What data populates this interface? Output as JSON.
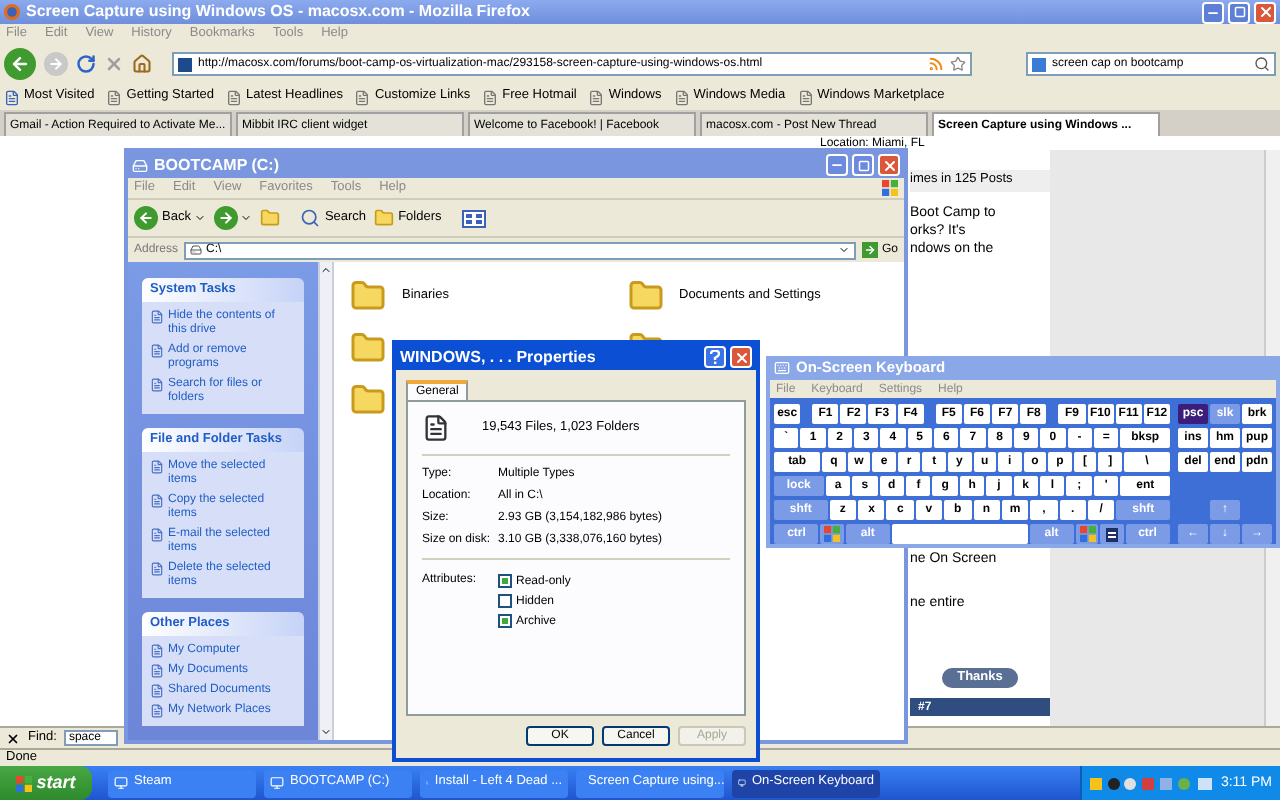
{
  "browser": {
    "title": "Screen Capture using Windows OS - macosx.com - Mozilla Firefox",
    "menu": [
      "File",
      "Edit",
      "View",
      "History",
      "Bookmarks",
      "Tools",
      "Help"
    ],
    "url": "http://macosx.com/forums/boot-camp-os-virtualization-mac/293158-screen-capture-using-windows-os.html",
    "search": "screen cap on bootcamp",
    "bookmarks": [
      "Most Visited",
      "Getting Started",
      "Latest Headlines",
      "Customize Links",
      "Free Hotmail",
      "Windows",
      "Windows Media",
      "Windows Marketplace"
    ],
    "tabs": [
      {
        "label": "Gmail - Action Required to Activate Me...",
        "selected": false
      },
      {
        "label": "Mibbit IRC client widget",
        "selected": false
      },
      {
        "label": "Welcome to Facebook! | Facebook",
        "selected": false
      },
      {
        "label": "macosx.com - Post New Thread",
        "selected": false
      },
      {
        "label": "Screen Capture using Windows ...",
        "selected": true
      }
    ],
    "page": {
      "location": "Location: Miami, FL",
      "posts": "imes in 125 Posts",
      "lines": [
        "Boot Camp to",
        "orks? It's",
        "ndows on the"
      ],
      "lines_lower": [
        "ne On Screen",
        "ne entire"
      ],
      "thanks": "Thanks",
      "post_number": "#7"
    },
    "find": {
      "label": "Find:",
      "value": "space"
    },
    "status": "Done"
  },
  "explorer": {
    "title": "BOOTCAMP (C:)",
    "menu": [
      "File",
      "Edit",
      "View",
      "Favorites",
      "Tools",
      "Help"
    ],
    "back": "Back",
    "search": "Search",
    "folders_button": "Folders",
    "address_label": "Address",
    "address": "C:\\",
    "go": "Go",
    "panels": [
      {
        "title": "System Tasks",
        "items": [
          "Hide the contents of this drive",
          "Add or remove programs",
          "Search for files or folders"
        ]
      },
      {
        "title": "File and Folder Tasks",
        "items": [
          "Move the selected items",
          "Copy the selected items",
          "E-mail the selected items",
          "Delete the selected items"
        ]
      },
      {
        "title": "Other Places",
        "items": [
          "My Computer",
          "My Documents",
          "Shared Documents",
          "My Network Places"
        ]
      }
    ],
    "folders": [
      "Binaries",
      "Documents and Settings"
    ]
  },
  "properties": {
    "title": "WINDOWS, . . . Properties",
    "tabs": [
      {
        "label": "General",
        "selected": true
      }
    ],
    "summary": "19,543 Files, 1,023 Folders",
    "fields": [
      {
        "label": "Type:",
        "value": "Multiple Types"
      },
      {
        "label": "Location:",
        "value": "All in C:\\"
      },
      {
        "label": "Size:",
        "value": "2.93 GB (3,154,182,986 bytes)"
      },
      {
        "label": "Size on disk:",
        "value": "3.10 GB (3,338,076,160 bytes)"
      }
    ],
    "attributes_label": "Attributes:",
    "attributes": [
      {
        "label": "Read-only",
        "checked": true
      },
      {
        "label": "Hidden",
        "checked": false
      },
      {
        "label": "Archive",
        "checked": true
      }
    ],
    "buttons": [
      {
        "label": "OK",
        "disabled": false
      },
      {
        "label": "Cancel",
        "disabled": false
      },
      {
        "label": "Apply",
        "disabled": true
      }
    ]
  },
  "keyboard": {
    "title": "On-Screen Keyboard",
    "menu": [
      "File",
      "Keyboard",
      "Settings",
      "Help"
    ],
    "key_lines": [
      [
        {
          "label": "esc",
          "kind": "key",
          "pressed": false
        },
        {
          "label": "F1",
          "kind": "key",
          "pressed": false
        },
        {
          "label": "F2",
          "kind": "key",
          "pressed": false
        },
        {
          "label": "F3",
          "kind": "key",
          "pressed": false
        },
        {
          "label": "F4",
          "kind": "key",
          "pressed": false
        },
        {
          "label": "F5",
          "kind": "key",
          "pressed": false
        },
        {
          "label": "F6",
          "kind": "key",
          "pressed": false
        },
        {
          "label": "F7",
          "kind": "key",
          "pressed": false
        },
        {
          "label": "F8",
          "kind": "key",
          "pressed": false
        },
        {
          "label": "F9",
          "kind": "key",
          "pressed": false
        },
        {
          "label": "F10",
          "kind": "key",
          "pressed": false
        },
        {
          "label": "F11",
          "kind": "key",
          "pressed": false
        },
        {
          "label": "F12",
          "kind": "key",
          "pressed": false
        }
      ],
      [
        {
          "label": "`",
          "kind": "key",
          "pressed": false
        },
        {
          "label": "1",
          "kind": "key",
          "pressed": false
        },
        {
          "label": "2",
          "kind": "key",
          "pressed": false
        },
        {
          "label": "3",
          "kind": "key",
          "pressed": false
        },
        {
          "label": "4",
          "kind": "key",
          "pressed": false
        },
        {
          "label": "5",
          "kind": "key",
          "pressed": false
        },
        {
          "label": "6",
          "kind": "key",
          "pressed": false
        },
        {
          "label": "7",
          "kind": "key",
          "pressed": false
        },
        {
          "label": "8",
          "kind": "key",
          "pressed": false
        },
        {
          "label": "9",
          "kind": "key",
          "pressed": false
        },
        {
          "label": "0",
          "kind": "key",
          "pressed": false
        },
        {
          "label": "-",
          "kind": "key",
          "pressed": false
        },
        {
          "label": "=",
          "kind": "key",
          "pressed": false
        },
        {
          "label": "bksp",
          "kind": "wide",
          "pressed": false
        }
      ],
      [
        {
          "label": "tab",
          "kind": "wide",
          "pressed": false
        },
        {
          "label": "q",
          "kind": "key",
          "pressed": false
        },
        {
          "label": "w",
          "kind": "key",
          "pressed": false
        },
        {
          "label": "e",
          "kind": "key",
          "pressed": false
        },
        {
          "label": "r",
          "kind": "key",
          "pressed": false
        },
        {
          "label": "t",
          "kind": "key",
          "pressed": false
        },
        {
          "label": "y",
          "kind": "key",
          "pressed": false
        },
        {
          "label": "u",
          "kind": "key",
          "pressed": false
        },
        {
          "label": "i",
          "kind": "key",
          "pressed": false
        },
        {
          "label": "o",
          "kind": "key",
          "pressed": false
        },
        {
          "label": "p",
          "kind": "key",
          "pressed": false
        },
        {
          "label": "[",
          "kind": "key",
          "pressed": false
        },
        {
          "label": "]",
          "kind": "key",
          "pressed": false
        },
        {
          "label": "\\",
          "kind": "wide",
          "pressed": false
        }
      ],
      [
        {
          "label": "lock",
          "kind": "mod",
          "pressed": false
        },
        {
          "label": "a",
          "kind": "key",
          "pressed": false
        },
        {
          "label": "s",
          "kind": "key",
          "pressed": false
        },
        {
          "label": "d",
          "kind": "key",
          "pressed": false
        },
        {
          "label": "f",
          "kind": "key",
          "pressed": false
        },
        {
          "label": "g",
          "kind": "key",
          "pressed": false
        },
        {
          "label": "h",
          "kind": "key",
          "pressed": false
        },
        {
          "label": "j",
          "kind": "key",
          "pressed": false
        },
        {
          "label": "k",
          "kind": "key",
          "pressed": false
        },
        {
          "label": "l",
          "kind": "key",
          "pressed": false
        },
        {
          "label": ";",
          "kind": "key",
          "pressed": false
        },
        {
          "label": "'",
          "kind": "key",
          "pressed": false
        },
        {
          "label": "ent",
          "kind": "wide",
          "pressed": false
        }
      ],
      [
        {
          "label": "shft",
          "kind": "mod",
          "pressed": false
        },
        {
          "label": "z",
          "kind": "key",
          "pressed": false
        },
        {
          "label": "x",
          "kind": "key",
          "pressed": false
        },
        {
          "label": "c",
          "kind": "key",
          "pressed": false
        },
        {
          "label": "v",
          "kind": "key",
          "pressed": false
        },
        {
          "label": "b",
          "kind": "key",
          "pressed": false
        },
        {
          "label": "n",
          "kind": "key",
          "pressed": false
        },
        {
          "label": "m",
          "kind": "key",
          "pressed": false
        },
        {
          "label": ",",
          "kind": "key",
          "pressed": false
        },
        {
          "label": ".",
          "kind": "key",
          "pressed": false
        },
        {
          "label": "/",
          "kind": "key",
          "pressed": false
        },
        {
          "label": "shft",
          "kind": "mod",
          "pressed": false
        }
      ],
      [
        {
          "label": "ctrl",
          "kind": "mod",
          "pressed": false
        },
        {
          "kind": "win",
          "pressed": false
        },
        {
          "label": "alt",
          "kind": "mod",
          "pressed": false
        },
        {
          "kind": "space",
          "pressed": false
        },
        {
          "label": "alt",
          "kind": "mod",
          "pressed": false
        },
        {
          "kind": "win",
          "pressed": false
        },
        {
          "kind": "menu",
          "pressed": false
        },
        {
          "label": "ctrl",
          "kind": "mod",
          "pressed": false
        }
      ]
    ],
    "nav_lines": [
      [
        {
          "label": "psc",
          "kind": "nav",
          "pressed": true
        },
        {
          "label": "slk",
          "kind": "navmod",
          "pressed": false
        },
        {
          "label": "brk",
          "kind": "nav",
          "pressed": false
        }
      ],
      [
        {
          "label": "ins",
          "kind": "nav",
          "pressed": false
        },
        {
          "label": "hm",
          "kind": "nav",
          "pressed": false
        },
        {
          "label": "pup",
          "kind": "nav",
          "pressed": false
        }
      ],
      [
        {
          "label": "del",
          "kind": "nav",
          "pressed": false
        },
        {
          "label": "end",
          "kind": "nav",
          "pressed": false
        },
        {
          "label": "pdn",
          "kind": "nav",
          "pressed": false
        }
      ]
    ],
    "arrow_lines": [
      [
        {
          "label": "↑",
          "kind": "navmod",
          "pressed": false
        }
      ],
      [
        {
          "label": "←",
          "kind": "navmod",
          "pressed": false
        },
        {
          "label": "↓",
          "kind": "navmod",
          "pressed": false
        },
        {
          "label": "→",
          "kind": "navmod",
          "pressed": false
        }
      ]
    ]
  },
  "taskbar": {
    "start": "start",
    "items": [
      {
        "label": "Steam",
        "selected": false
      },
      {
        "label": "BOOTCAMP (C:)",
        "selected": false
      },
      {
        "label": "Install - Left 4 Dead ...",
        "selected": false
      },
      {
        "label": "Screen Capture using...",
        "selected": false
      },
      {
        "label": "On-Screen Keyboard",
        "selected": true
      }
    ],
    "clock": "3:11 PM"
  }
}
